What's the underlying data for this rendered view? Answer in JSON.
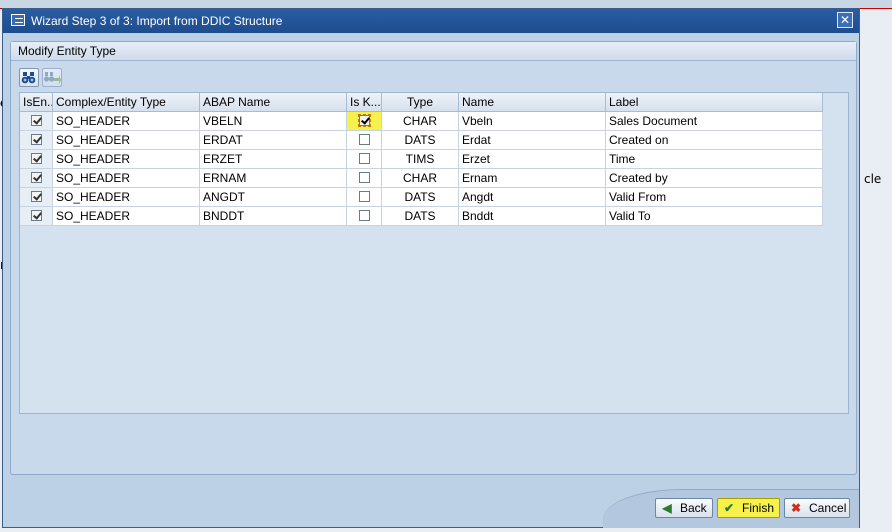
{
  "dialog": {
    "title": "Wizard Step 3 of 3: Import from DDIC Structure",
    "close_glyph": "✕"
  },
  "background": {
    "frag_e": "e",
    "frag_cle": "cle",
    "frag_n": "n"
  },
  "panel": {
    "header": "Modify Entity Type"
  },
  "toolbar": {
    "find_icon": "binoculars-icon",
    "find_next_icon": "find-next-icon"
  },
  "table": {
    "columns": [
      "IsEn...",
      "Complex/Entity Type",
      "ABAP Name",
      "Is K...",
      "Type",
      "Name",
      "Label"
    ],
    "rows": [
      {
        "is_entity": true,
        "entity_type": "SO_HEADER",
        "abap_name": "VBELN",
        "is_key": true,
        "type": "CHAR",
        "name": "Vbeln",
        "label": "Sales Document"
      },
      {
        "is_entity": true,
        "entity_type": "SO_HEADER",
        "abap_name": "ERDAT",
        "is_key": false,
        "type": "DATS",
        "name": "Erdat",
        "label": "Created on"
      },
      {
        "is_entity": true,
        "entity_type": "SO_HEADER",
        "abap_name": "ERZET",
        "is_key": false,
        "type": "TIMS",
        "name": "Erzet",
        "label": "Time"
      },
      {
        "is_entity": true,
        "entity_type": "SO_HEADER",
        "abap_name": "ERNAM",
        "is_key": false,
        "type": "CHAR",
        "name": "Ernam",
        "label": "Created by"
      },
      {
        "is_entity": true,
        "entity_type": "SO_HEADER",
        "abap_name": "ANGDT",
        "is_key": false,
        "type": "DATS",
        "name": "Angdt",
        "label": "Valid From"
      },
      {
        "is_entity": true,
        "entity_type": "SO_HEADER",
        "abap_name": "BNDDT",
        "is_key": false,
        "type": "DATS",
        "name": "Bnddt",
        "label": "Valid To"
      }
    ]
  },
  "footer": {
    "back_label": "Back",
    "finish_label": "Finish",
    "cancel_label": "Cancel"
  },
  "colors": {
    "title_bar": "#1e4c8f",
    "highlight": "#f7f14c",
    "panel": "#c8d9ec"
  }
}
